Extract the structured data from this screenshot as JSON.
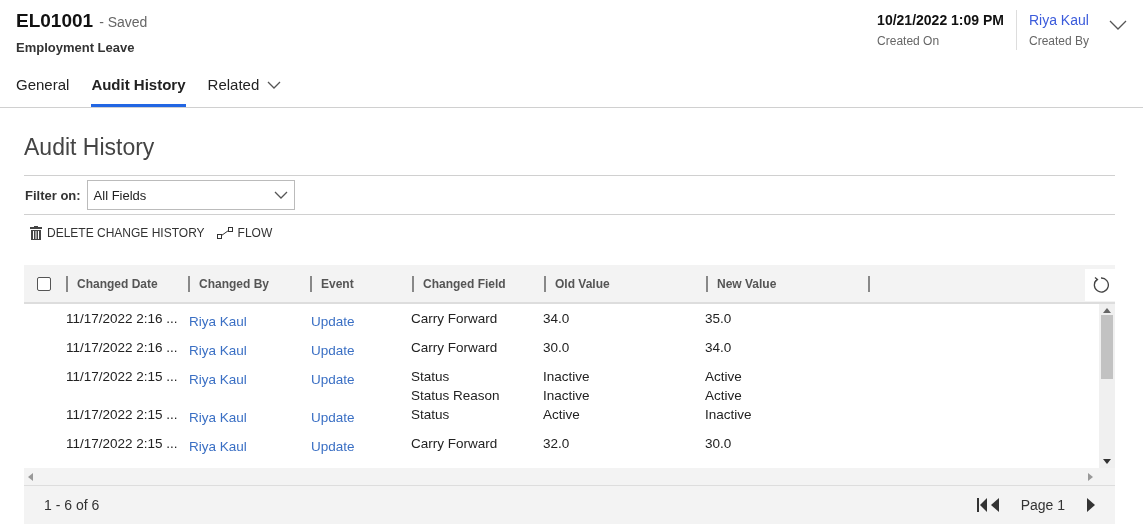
{
  "record": {
    "id": "EL01001",
    "status": "- Saved",
    "entity": "Employment Leave"
  },
  "header_fields": [
    {
      "value": "10/21/2022 1:09 PM",
      "label": "Created On",
      "kind": "text"
    },
    {
      "value": "Riya Kaul",
      "label": "Created By",
      "kind": "link"
    }
  ],
  "tabs": [
    {
      "label": "General",
      "selected": false,
      "dropdown": false
    },
    {
      "label": "Audit History",
      "selected": true,
      "dropdown": false
    },
    {
      "label": "Related",
      "selected": false,
      "dropdown": true
    }
  ],
  "section_title": "Audit History",
  "filter": {
    "label": "Filter on:",
    "value": "All Fields"
  },
  "toolbar": [
    {
      "label": "DELETE CHANGE HISTORY",
      "kind": "delete"
    },
    {
      "label": "FLOW",
      "kind": "flow"
    }
  ],
  "table": {
    "select_all_checked": false,
    "columns": [
      "Changed Date",
      "Changed By",
      "Event",
      "Changed Field",
      "Old Value",
      "New Value"
    ],
    "rows": [
      {
        "date": "11/17/2022 2:16 ...",
        "changed_by": "Riya Kaul",
        "event": "Update",
        "changes": [
          {
            "field": "Carry Forward",
            "old": "34.0",
            "new": "35.0"
          }
        ]
      },
      {
        "date": "11/17/2022 2:16 ...",
        "changed_by": "Riya Kaul",
        "event": "Update",
        "changes": [
          {
            "field": "Carry Forward",
            "old": "30.0",
            "new": "34.0"
          }
        ]
      },
      {
        "date": "11/17/2022 2:15 ...",
        "changed_by": "Riya Kaul",
        "event": "Update",
        "changes": [
          {
            "field": "Status",
            "old": "Inactive",
            "new": "Active"
          },
          {
            "field": "Status Reason",
            "old": "Inactive",
            "new": "Active"
          }
        ]
      },
      {
        "date": "11/17/2022 2:15 ...",
        "changed_by": "Riya Kaul",
        "event": "Update",
        "changes": [
          {
            "field": "Status",
            "old": "Active",
            "new": "Inactive"
          }
        ]
      },
      {
        "date": "11/17/2022 2:15 ...",
        "changed_by": "Riya Kaul",
        "event": "Update",
        "changes": [
          {
            "field": "Carry Forward",
            "old": "32.0",
            "new": "30.0"
          }
        ]
      }
    ]
  },
  "footer": {
    "count": "1 - 6 of 6",
    "page": "Page 1"
  }
}
